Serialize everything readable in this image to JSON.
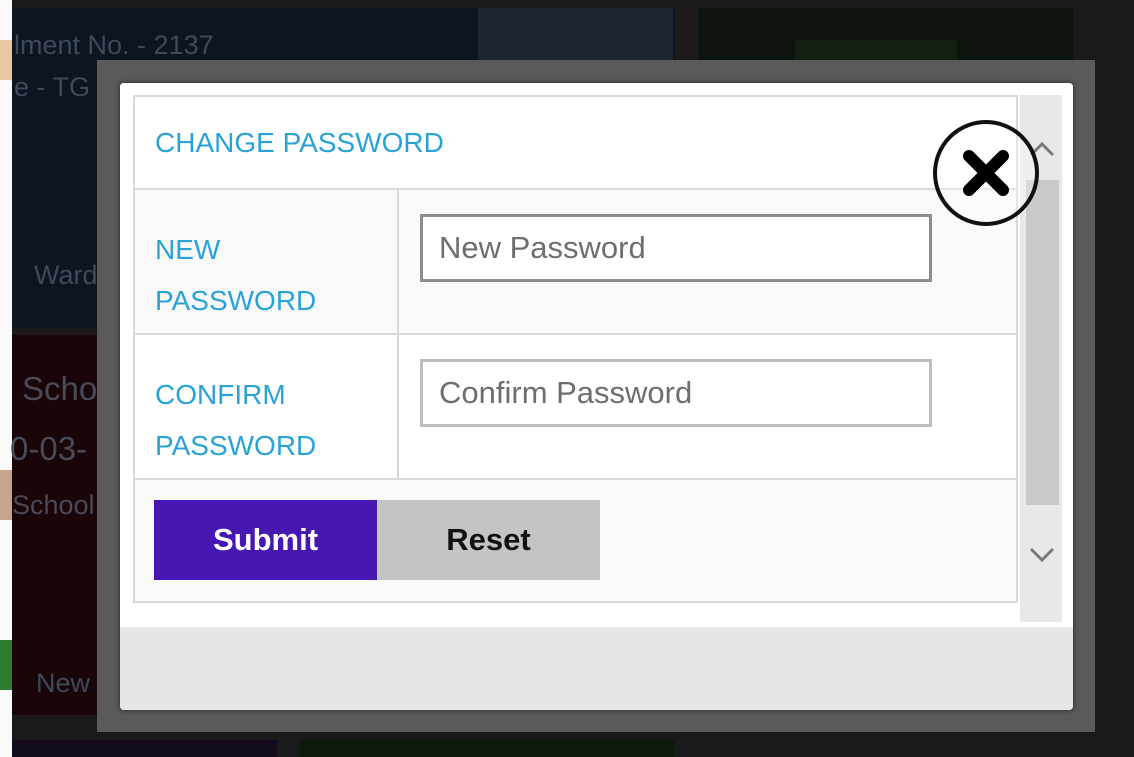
{
  "background": {
    "enrollment_text": "lment No. - 2137",
    "grade_text": "e - TG",
    "ward_text": "Ward",
    "school_text": "Scho",
    "date_text": "0-03-",
    "school_text_2": "School",
    "news_text": "New",
    "colors": {
      "dark_navy": "#0f1520",
      "dark_red": "#1a0508",
      "dark_green": "#0d1a0d",
      "dark_purple": "#140a1e"
    }
  },
  "modal": {
    "title": "CHANGE PASSWORD",
    "new_password": {
      "label_line1": "NEW",
      "label_line2": "PASSWORD",
      "placeholder": "New Password"
    },
    "confirm_password": {
      "label_line1": "CONFIRM",
      "label_line2": "PASSWORD",
      "placeholder": "Confirm Password"
    },
    "buttons": {
      "submit": "Submit",
      "reset": "Reset"
    },
    "icons": {
      "close": "close-x-icon",
      "scroll_up": "chevron-up-icon",
      "scroll_down": "chevron-down-icon"
    },
    "colors": {
      "accent_label": "#29a3d6",
      "submit_bg": "#4717b2",
      "reset_bg": "#c4c4c4"
    }
  }
}
